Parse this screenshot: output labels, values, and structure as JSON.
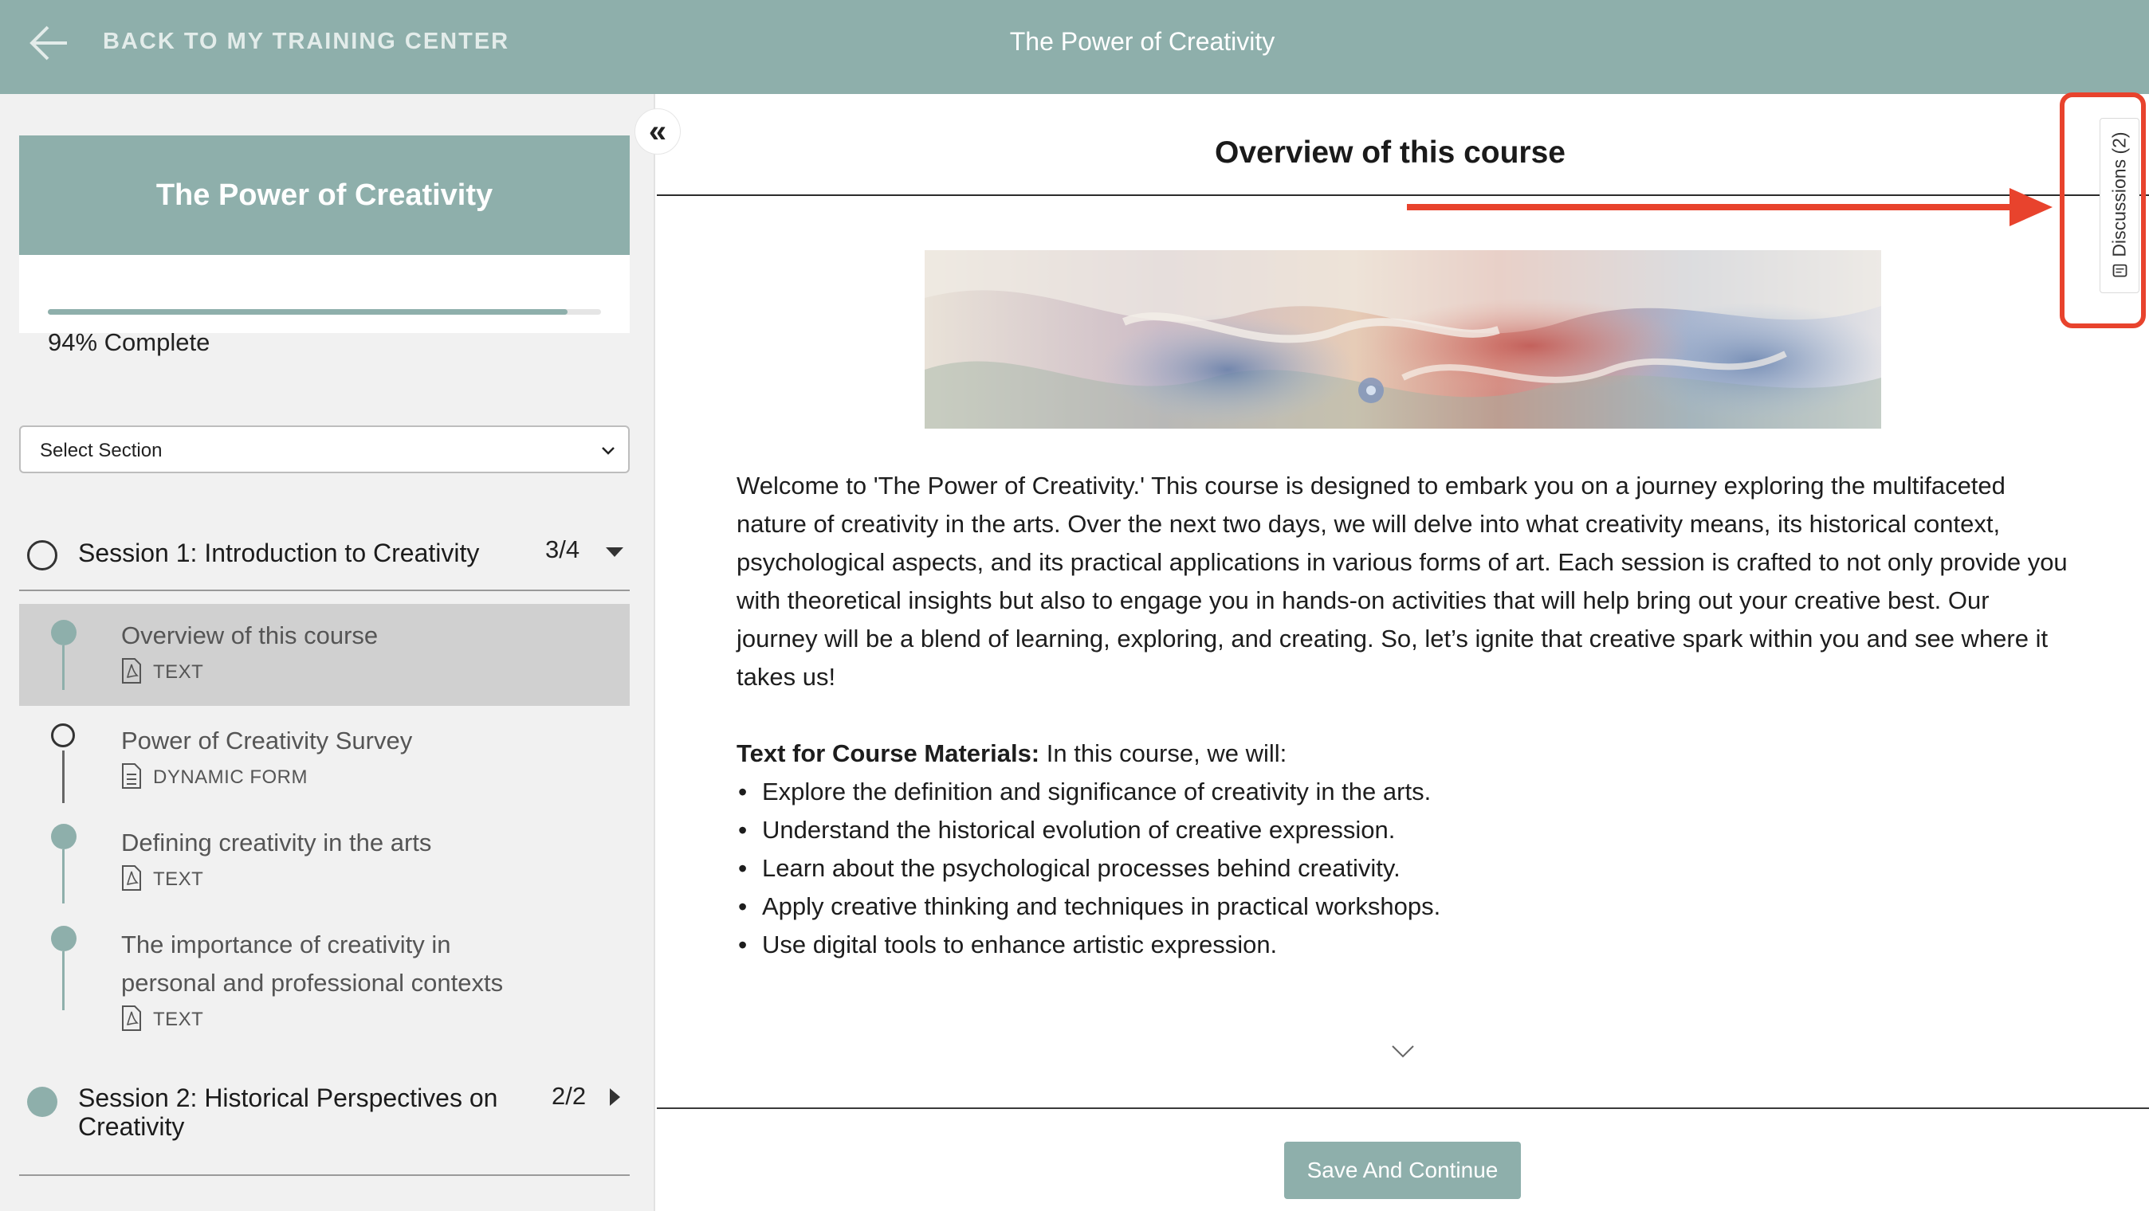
{
  "header": {
    "back_label": "BACK TO MY TRAINING CENTER",
    "title": "The Power of Creativity"
  },
  "sidebar": {
    "course_title": "The Power of Creativity",
    "progress_percent": 94,
    "progress_text": "94% Complete",
    "select_section_label": "Select Section",
    "sessions": [
      {
        "title": "Session 1: Introduction to Creativity",
        "count": "3/4",
        "status": "incomplete",
        "expanded": true,
        "lessons": [
          {
            "title": "Overview of this course",
            "type": "TEXT",
            "status": "complete",
            "active": true
          },
          {
            "title": "Power of Creativity Survey",
            "type": "DYNAMIC FORM",
            "status": "incomplete",
            "active": false
          },
          {
            "title": "Defining creativity in the arts",
            "type": "TEXT",
            "status": "complete",
            "active": false
          },
          {
            "title_line1": "The importance of creativity in",
            "title_line2": "personal and professional contexts",
            "type": "TEXT",
            "status": "complete",
            "active": false
          }
        ]
      },
      {
        "title_line1": "Session 2: Historical Perspectives on",
        "title_line2": "Creativity",
        "count": "2/2",
        "status": "complete",
        "expanded": false
      }
    ]
  },
  "main": {
    "title": "Overview of this course",
    "intro_lines": [
      "Welcome to 'The Power of Creativity.' This course is designed to embark you on a journey exploring the multifaceted",
      "nature of creativity in the arts. Over the next two days, we will delve into what creativity means, its historical context,",
      "psychological aspects, and its practical applications in various forms of art. Each session is crafted to not only provide you",
      "with theoretical insights but also to engage you in hands-on activities that will help bring out your creative best. Our",
      "journey will be a blend of learning, exploring, and creating. So, let’s ignite that creative spark within you and see where it",
      "takes us!"
    ],
    "materials_label": "Text for Course Materials:",
    "materials_intro": " In this course, we will:",
    "materials_items": [
      "Explore the definition and significance of creativity in the arts.",
      "Understand the historical evolution of creative expression.",
      "Learn about the psychological processes behind creativity.",
      "Apply creative thinking and techniques in practical workshops.",
      "Use digital tools to enhance artistic expression."
    ],
    "save_button": "Save And Continue"
  },
  "discussions_tab": {
    "label": "Discussions (2)"
  },
  "colors": {
    "accent": "#8eafab",
    "highlight_red": "#e8432d",
    "active_row": "#d0d0d0"
  }
}
